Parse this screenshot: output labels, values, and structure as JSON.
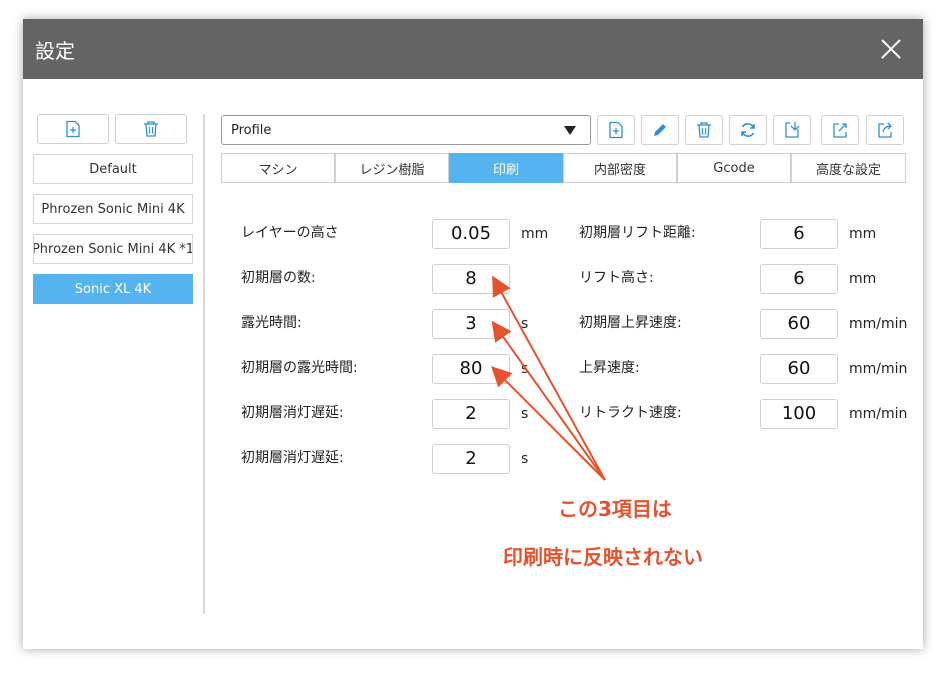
{
  "window": {
    "title": "設定"
  },
  "sidebar": {
    "profiles": [
      {
        "label": "Default",
        "selected": false
      },
      {
        "label": "Phrozen Sonic Mini 4K",
        "selected": false
      },
      {
        "label": "Phrozen Sonic Mini 4K *1",
        "selected": false
      },
      {
        "label": "Sonic XL 4K",
        "selected": true
      }
    ],
    "buttons": [
      "new-file-icon",
      "trash-icon"
    ]
  },
  "toolbar": {
    "profile_select_value": "Profile",
    "icons": [
      "new-file-icon",
      "pencil-icon",
      "trash-icon",
      "refresh-icon",
      "import-icon",
      "export-icon",
      "share-icon"
    ]
  },
  "tabs": [
    {
      "label": "マシン",
      "active": false
    },
    {
      "label": "レジン樹脂",
      "active": false
    },
    {
      "label": "印刷",
      "active": true
    },
    {
      "label": "内部密度",
      "active": false
    },
    {
      "label": "Gcode",
      "active": false
    },
    {
      "label": "高度な設定",
      "active": false
    }
  ],
  "left_params": [
    {
      "label": "レイヤーの高さ",
      "value": "0.05",
      "unit": "mm"
    },
    {
      "label": "初期層の数:",
      "value": "8",
      "unit": ""
    },
    {
      "label": "露光時間:",
      "value": "3",
      "unit": "s"
    },
    {
      "label": "初期層の露光時間:",
      "value": "80",
      "unit": "s"
    },
    {
      "label": "初期層消灯遅延:",
      "value": "2",
      "unit": "s"
    },
    {
      "label": "初期層消灯遅延:",
      "value": "2",
      "unit": "s"
    }
  ],
  "right_params": [
    {
      "label": "初期層リフト距離:",
      "value": "6",
      "unit": "mm"
    },
    {
      "label": "リフト高さ:",
      "value": "6",
      "unit": "mm"
    },
    {
      "label": "初期層上昇速度:",
      "value": "60",
      "unit": "mm/min"
    },
    {
      "label": "上昇速度:",
      "value": "60",
      "unit": "mm/min"
    },
    {
      "label": "リトラクト速度:",
      "value": "100",
      "unit": "mm/min"
    }
  ],
  "annotation": {
    "line1": "この3項目は",
    "line2": "印刷時に反映されない",
    "color": "#e5532e"
  },
  "colors": {
    "accent": "#55b4ef",
    "titlebar": "#646464"
  }
}
